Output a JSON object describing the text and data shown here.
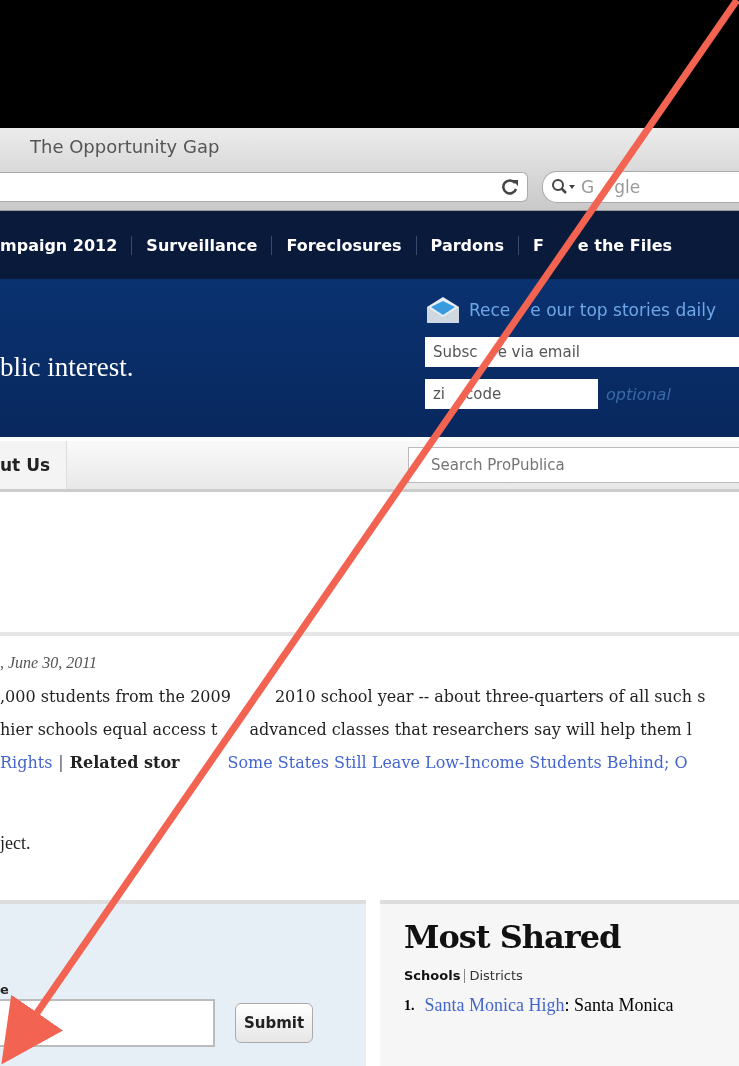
{
  "browser": {
    "title": "The Opportunity Gap",
    "search_placeholder": [
      "G",
      "gle"
    ]
  },
  "nav": {
    "items": [
      [
        "mpaign 2012"
      ],
      [
        "Surveillance"
      ],
      [
        "Foreclosures"
      ],
      [
        "Pardons"
      ],
      [
        "F",
        "e the Files"
      ]
    ]
  },
  "header": {
    "tagline": "blic interest.",
    "newsletter": {
      "prompt": [
        "Rece",
        "e our top stories daily"
      ],
      "email_placeholder": [
        "Subsc",
        "e via email"
      ],
      "zip_placeholder": [
        "zi",
        "code"
      ],
      "zip_note": "optional"
    }
  },
  "menu": {
    "tabs": [
      {
        "label": "ut Us"
      }
    ],
    "search_placeholder": "Search ProPublica"
  },
  "article": {
    "date": ", June 30, 2011",
    "lines": [
      [
        ",000 students from the 2009",
        "2010 school year -- about three-quarters of all such s"
      ],
      [
        "hier schools equal access t",
        "advanced classes that researchers say will help them l"
      ]
    ],
    "topic_link": "Rights",
    "separator": "|",
    "related_label": "Related stor",
    "related_link": "Some States Still Leave Low-Income Students Behind; O",
    "note": "ject."
  },
  "lookup": {
    "label": "e",
    "button": "Submit"
  },
  "most_shared": {
    "title": "Most Shared",
    "tabs": [
      {
        "label": "Schools",
        "selected": true
      },
      {
        "label": "Districts",
        "selected": false
      }
    ],
    "items": [
      {
        "number": "1.",
        "name": "Santa Monica High",
        "detail": ": Santa Monica"
      }
    ]
  }
}
